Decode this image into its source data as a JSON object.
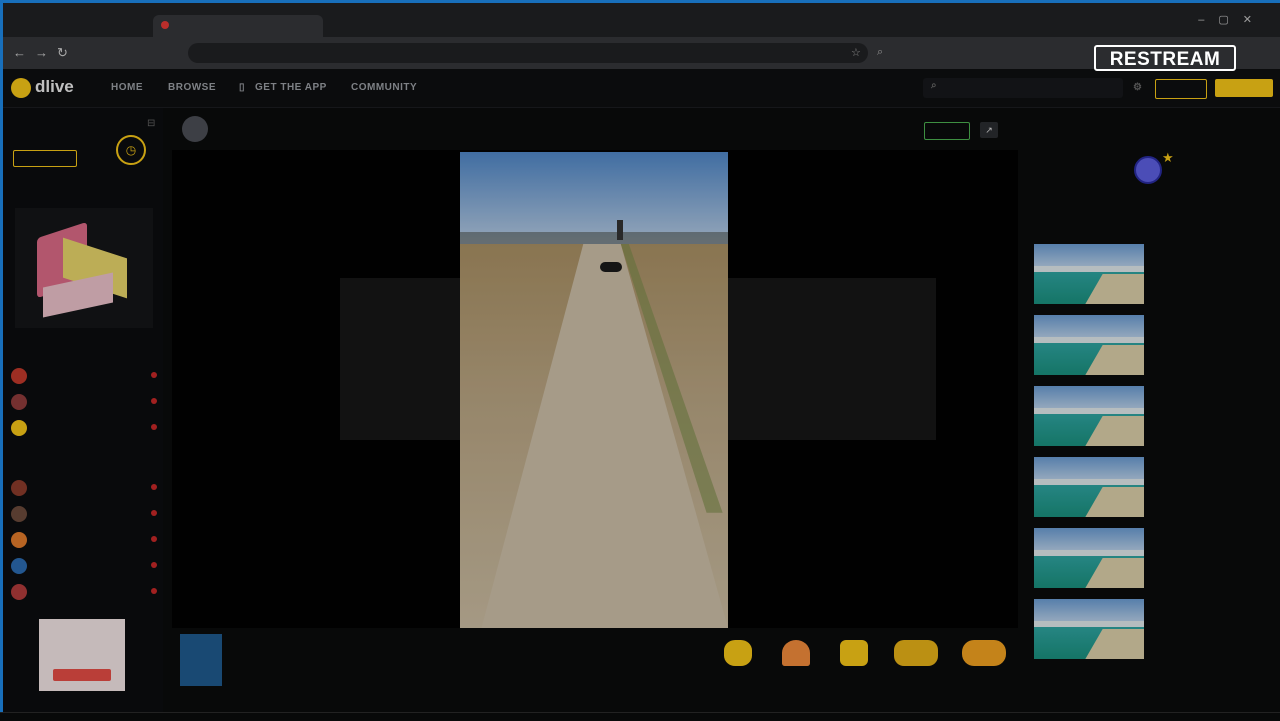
{
  "browser": {
    "tabs": [
      "",
      ""
    ],
    "address": "",
    "search_placeholder": ""
  },
  "overlay_badge": "RESTREAM",
  "site": {
    "logo": "dlive",
    "nav": [
      "HOME",
      "BROWSE",
      "GET THE APP",
      "COMMUNITY"
    ],
    "search_placeholder": "",
    "login": "",
    "signup": ""
  },
  "sidebar": {
    "section_pro": "",
    "gopro": "",
    "clock_label": "",
    "section_events": "",
    "section_recommended": "",
    "recommended": [
      {
        "name": "",
        "sub": "",
        "color": "#c0392b"
      },
      {
        "name": "",
        "sub": "",
        "color": "#8e3b3b"
      },
      {
        "name": "",
        "sub": "",
        "color": "#f5c518"
      }
    ],
    "section_following": "",
    "following": [
      {
        "name": "",
        "sub": "",
        "color": "#8a3b2b"
      },
      {
        "name": "",
        "sub": "",
        "color": "#6b4a3b"
      },
      {
        "name": "",
        "sub": "",
        "color": "#e07a2b"
      },
      {
        "name": "",
        "sub": "",
        "color": "#2b6bb0"
      },
      {
        "name": "",
        "sub": "",
        "color": "#b03b3b"
      }
    ],
    "ad_text": ""
  },
  "stream": {
    "streamer": "",
    "stats": "",
    "follow": "",
    "title": "",
    "subtitle": "",
    "tag": "",
    "meta": "",
    "overlay_text_left": "",
    "overlay_text_right": ""
  },
  "gifts": [
    {
      "label": "",
      "price": "",
      "color": "#f5c518"
    },
    {
      "label": "",
      "price": "",
      "color": "#f08a3b"
    },
    {
      "label": "",
      "price": "",
      "color": "#f5c518"
    },
    {
      "label": "",
      "price": "",
      "color": "#e5b018"
    },
    {
      "label": "",
      "price": "",
      "color": "#f0a020"
    }
  ],
  "right_panel": {
    "top_label": "",
    "badge_label": "",
    "replays_label": "",
    "videos": [
      {
        "title": "",
        "channel": "",
        "meta": ""
      },
      {
        "title": "",
        "channel": "",
        "meta": ""
      },
      {
        "title": "",
        "channel": "",
        "meta": ""
      },
      {
        "title": "",
        "channel": "",
        "meta": ""
      },
      {
        "title": "",
        "channel": "",
        "meta": ""
      },
      {
        "title": "",
        "channel": "",
        "meta": ""
      }
    ]
  },
  "colors": {
    "accent": "#f5c518",
    "live": "#c62828",
    "follow": "#4caf50",
    "frame": "#1e88e5"
  }
}
